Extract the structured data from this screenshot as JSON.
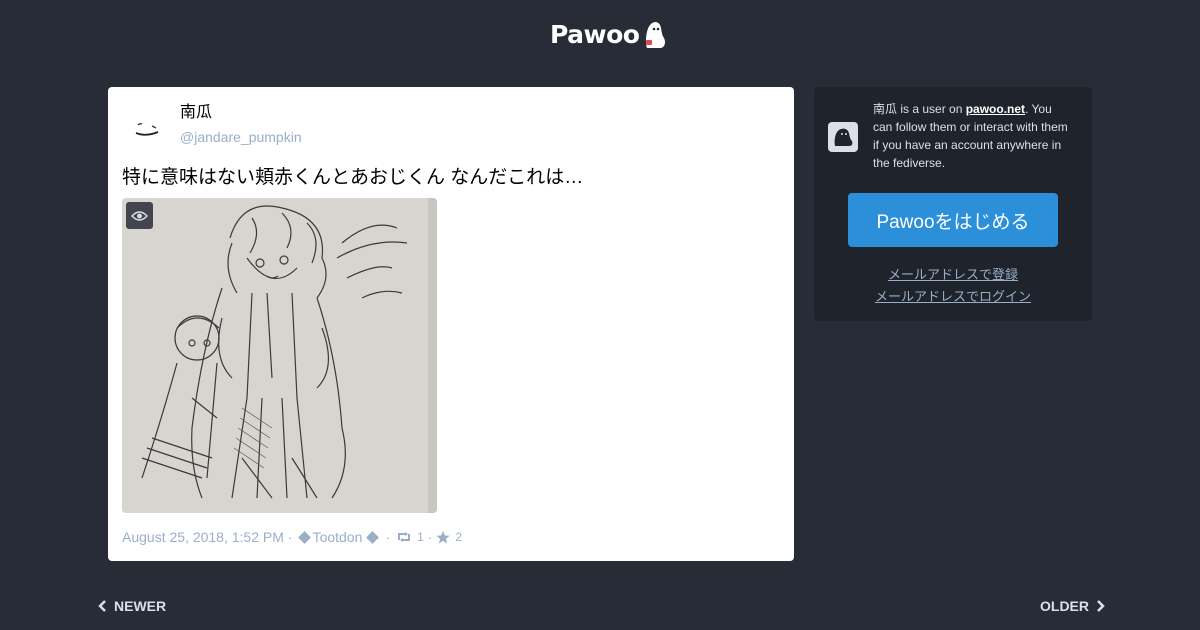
{
  "header": {
    "logo_text": "Pawoo",
    "logo_icon": "pawoo-mascot-icon"
  },
  "status": {
    "display_name": "南瓜",
    "acct": "@jandare_pumpkin",
    "content": "特に意味はない頬赤くんとあおじくん なんだこれは…",
    "media": {
      "alt": "pencil sketch illustration",
      "toggle_icon": "eye-icon"
    },
    "timestamp": "August 25, 2018, 1:52 PM",
    "separator": "·",
    "application": "Tootdon",
    "reblogs": "1",
    "favourites": "2",
    "reblog_icon": "retweet-icon",
    "favourite_icon": "star-icon"
  },
  "sidebar": {
    "intro_name": "南瓜",
    "intro_prefix": " is a user on ",
    "domain": "pawoo.net",
    "intro_suffix": ". You can follow them or interact with them if you have an account anywhere in the fediverse.",
    "cta_label": "Pawooをはじめる",
    "signup_link": "メールアドレスで登録",
    "login_link": "メールアドレスでログイン"
  },
  "pagination": {
    "newer": "NEWER",
    "older": "OLDER"
  },
  "colors": {
    "background": "#282c37",
    "card": "#ffffff",
    "sidebar": "#1f232b",
    "accent": "#2b90d9",
    "muted": "#9baec8",
    "light": "#d9e1e8"
  }
}
